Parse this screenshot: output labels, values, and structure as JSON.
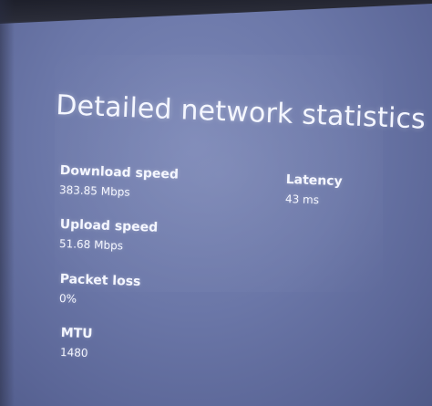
{
  "page": {
    "title": "Detailed network statistics"
  },
  "stats": {
    "download": {
      "label": "Download speed",
      "value": "383.85 Mbps"
    },
    "upload": {
      "label": "Upload speed",
      "value": "51.68 Mbps"
    },
    "packet_loss": {
      "label": "Packet loss",
      "value": "0%"
    },
    "mtu": {
      "label": "MTU",
      "value": "1480"
    },
    "latency": {
      "label": "Latency",
      "value": "43 ms"
    }
  },
  "colors": {
    "background": "#6b77a8",
    "text": "#f4f6ff"
  }
}
